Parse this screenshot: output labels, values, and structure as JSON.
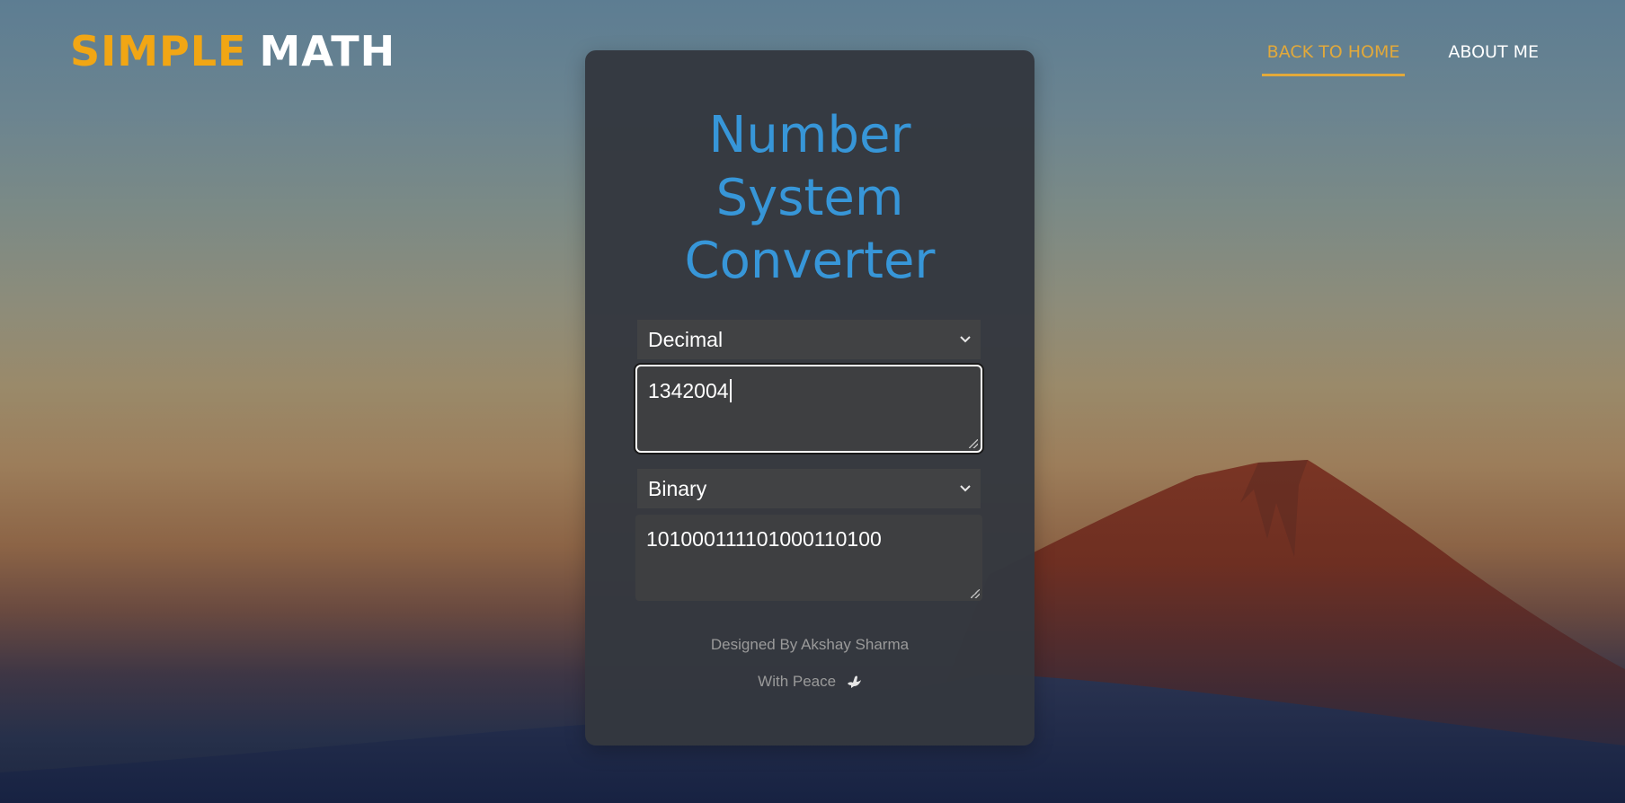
{
  "brand": {
    "part1": "SIMPLE",
    "part2": "MATH",
    "accent_color": "#f1a614"
  },
  "nav": {
    "items": [
      {
        "label": "BACK TO HOME",
        "active": true
      },
      {
        "label": "ABOUT ME",
        "active": false
      }
    ]
  },
  "converter": {
    "title": "Number System Converter",
    "from_select": {
      "selected": "Decimal"
    },
    "input": {
      "value": "1342004"
    },
    "to_select": {
      "selected": "Binary"
    },
    "output": {
      "value": "101000111101000110100"
    }
  },
  "footer": {
    "credit": "Designed By Akshay Sharma",
    "peace": "With Peace",
    "peace_icon": "dove-icon"
  },
  "colors": {
    "title": "#3796d8",
    "nav_active": "#e2a93a",
    "card_bg": "#34383f"
  }
}
